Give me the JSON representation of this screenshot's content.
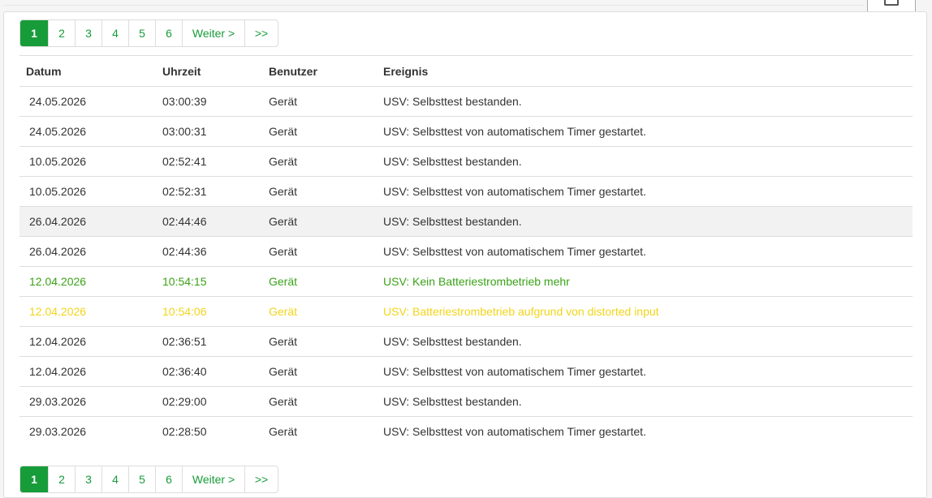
{
  "pagination": {
    "pages": [
      "1",
      "2",
      "3",
      "4",
      "5",
      "6"
    ],
    "active_page": "1",
    "next_label": "Weiter >",
    "last_label": ">>"
  },
  "table": {
    "headers": [
      "Datum",
      "Uhrzeit",
      "Benutzer",
      "Ereignis"
    ],
    "rows": [
      {
        "date": "24.05.2026",
        "time": "03:00:39",
        "user": "Gerät",
        "event": "USV: Selbsttest bestanden."
      },
      {
        "date": "24.05.2026",
        "time": "03:00:31",
        "user": "Gerät",
        "event": "USV: Selbsttest von automatischem Timer gestartet."
      },
      {
        "date": "10.05.2026",
        "time": "02:52:41",
        "user": "Gerät",
        "event": "USV: Selbsttest bestanden."
      },
      {
        "date": "10.05.2026",
        "time": "02:52:31",
        "user": "Gerät",
        "event": "USV: Selbsttest von automatischem Timer gestartet."
      },
      {
        "date": "26.04.2026",
        "time": "02:44:46",
        "user": "Gerät",
        "event": "USV: Selbsttest bestanden."
      },
      {
        "date": "26.04.2026",
        "time": "02:44:36",
        "user": "Gerät",
        "event": "USV: Selbsttest von automatischem Timer gestartet."
      },
      {
        "date": "12.04.2026",
        "time": "10:54:15",
        "user": "Gerät",
        "event": "USV: Kein Batteriestrombetrieb mehr"
      },
      {
        "date": "12.04.2026",
        "time": "10:54:06",
        "user": "Gerät",
        "event": "USV: Batteriestrombetrieb aufgrund von distorted input"
      },
      {
        "date": "12.04.2026",
        "time": "02:36:51",
        "user": "Gerät",
        "event": "USV: Selbsttest bestanden."
      },
      {
        "date": "12.04.2026",
        "time": "02:36:40",
        "user": "Gerät",
        "event": "USV: Selbsttest von automatischem Timer gestartet."
      },
      {
        "date": "29.03.2026",
        "time": "02:29:00",
        "user": "Gerät",
        "event": "USV: Selbsttest bestanden."
      },
      {
        "date": "29.03.2026",
        "time": "02:28:50",
        "user": "Gerät",
        "event": "USV: Selbsttest von automatischem Timer gestartet."
      }
    ]
  },
  "colors": {
    "accent": "#179c3a",
    "success_text": "#3aa317",
    "warning_text": "#f2d41a",
    "highlight_row": "#f2f2f2"
  },
  "icons": {
    "corner_button": "print-icon"
  }
}
